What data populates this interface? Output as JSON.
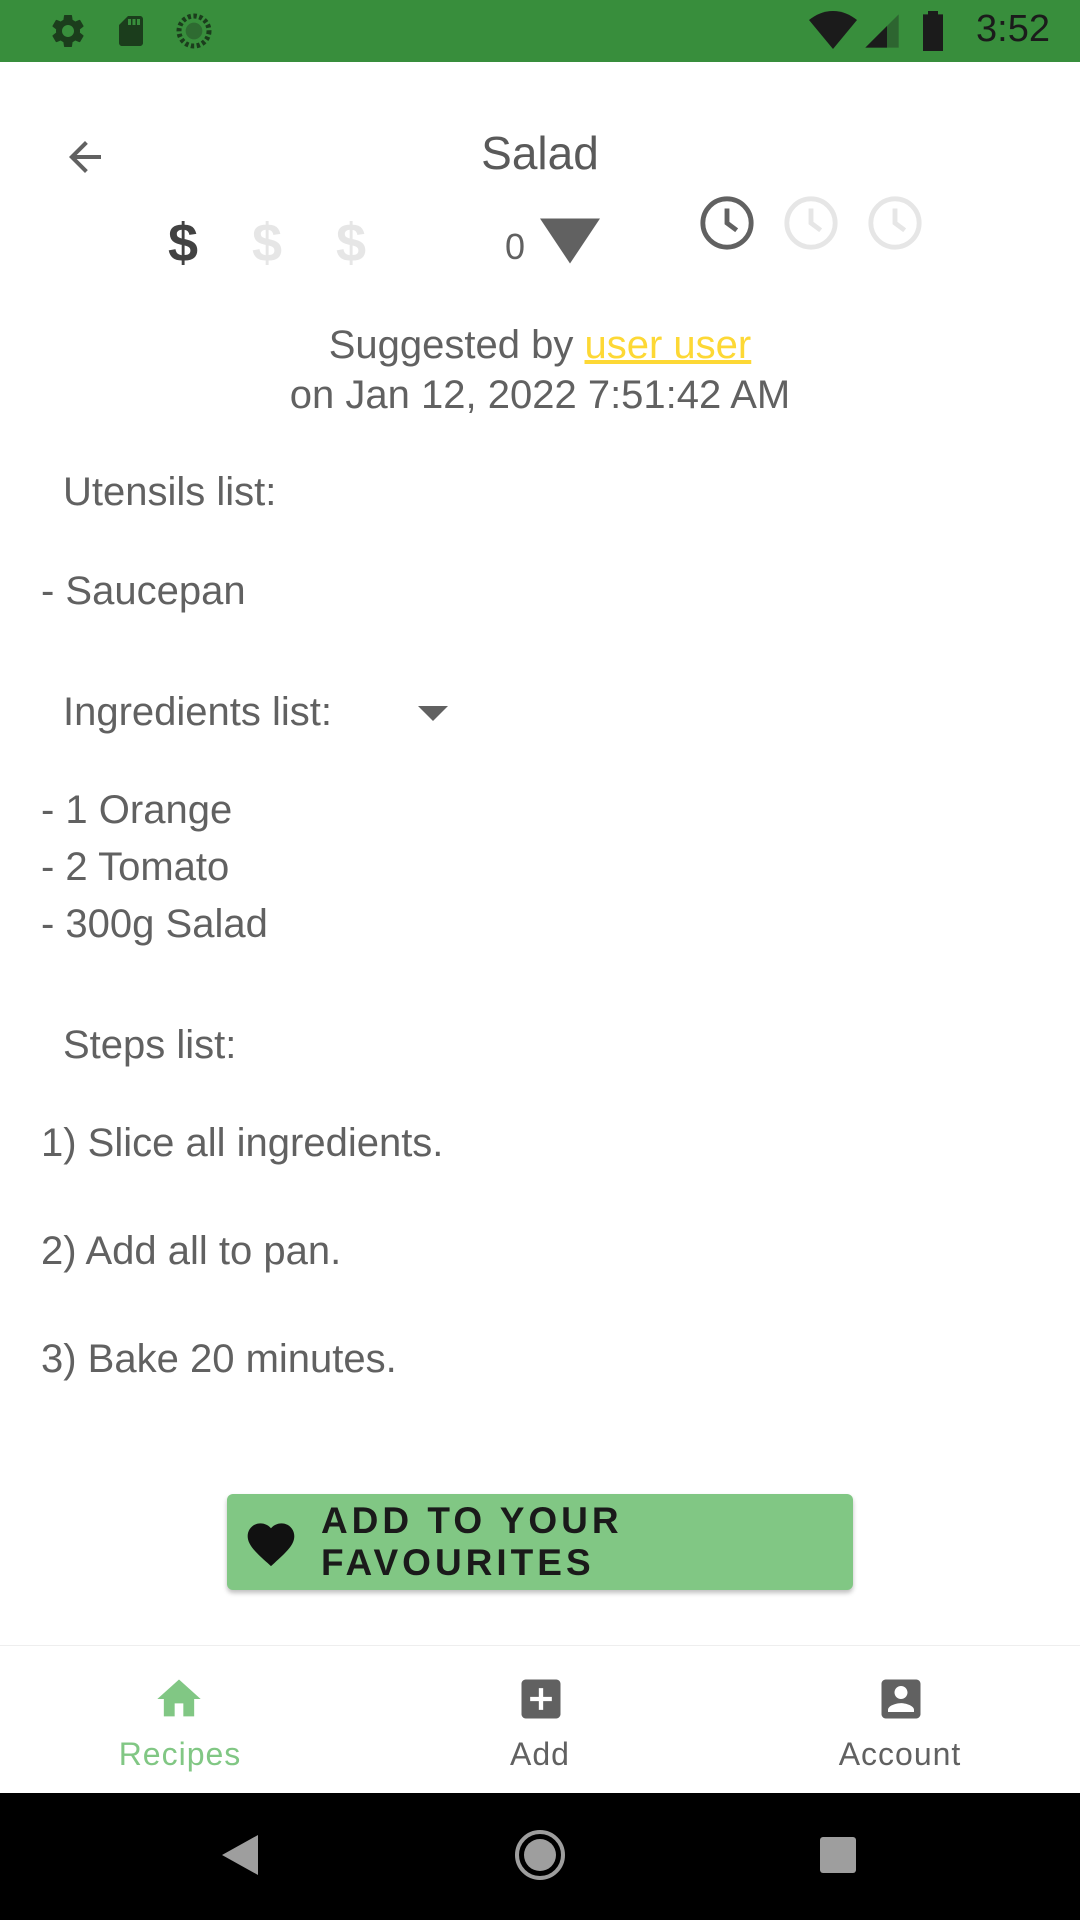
{
  "status_bar": {
    "time": "3:52",
    "color": "#388e3c"
  },
  "app_bar": {
    "title": "Salad"
  },
  "rating": {
    "likes_count": "0",
    "price_symbol": "$"
  },
  "suggestion": {
    "prefix": "Suggested by",
    "user": "user user",
    "date_line": "on Jan 12, 2022 7:51:42 AM",
    "link_color": "#fdd835"
  },
  "utensils": {
    "label": "Utensils list:",
    "items": [
      "- Saucepan"
    ]
  },
  "ingredients": {
    "label": "Ingredients list:",
    "items": [
      "- 1 Orange",
      "- 2 Tomato",
      "- 300g Salad"
    ]
  },
  "steps": {
    "label": "Steps list:",
    "items": [
      "1) Slice all ingredients.",
      "2) Add all to pan.",
      "3) Bake 20 minutes."
    ]
  },
  "favourite_button": {
    "label": "ADD TO YOUR FAVOURITES",
    "color": "#81c784"
  },
  "bottom_nav": {
    "items": [
      {
        "label": "Recipes",
        "icon": "home-icon",
        "active": true,
        "color": "#81c784"
      },
      {
        "label": "Add",
        "icon": "add-box-icon",
        "active": false,
        "color": "#616161"
      },
      {
        "label": "Account",
        "icon": "account-box-icon",
        "active": false,
        "color": "#616161"
      }
    ]
  }
}
